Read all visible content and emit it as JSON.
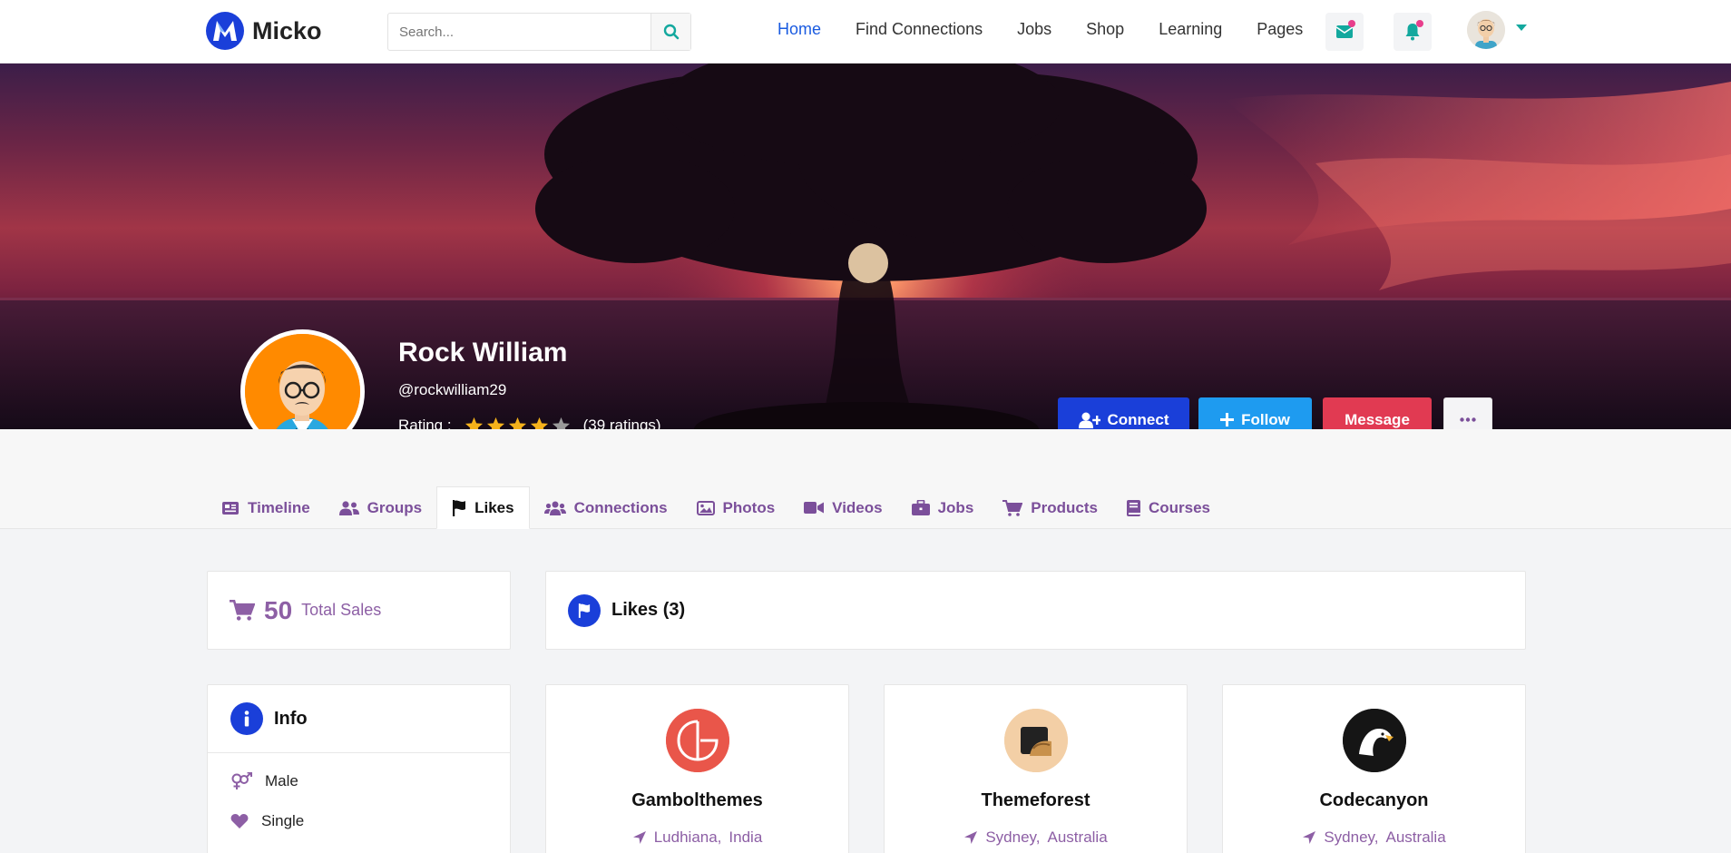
{
  "brand": {
    "name": "Micko",
    "accent": "#1a5be0"
  },
  "search": {
    "placeholder": "Search..."
  },
  "nav": [
    "Home",
    "Find Connections",
    "Jobs",
    "Shop",
    "Learning",
    "Pages"
  ],
  "header_icons": [
    "envelope-icon",
    "bell-icon"
  ],
  "profile": {
    "name": "Rock William",
    "handle": "@rockwilliam29",
    "rating_label": "Rating :",
    "rating_value": 4,
    "rating_max": 5,
    "rating_count": "(39 ratings)"
  },
  "actions": {
    "connect": "Connect",
    "follow": "Follow",
    "message": "Message"
  },
  "tabs": [
    "Timeline",
    "Groups",
    "Likes",
    "Connections",
    "Photos",
    "Videos",
    "Jobs",
    "Products",
    "Courses"
  ],
  "sales": {
    "count": "50",
    "label": "Total Sales"
  },
  "likes_section": {
    "title": "Likes (3)"
  },
  "info": {
    "title": "Info",
    "gender": "Male",
    "status": "Single"
  },
  "likes": [
    {
      "name": "Gambolthemes",
      "city": "Ludhiana,",
      "country": "India"
    },
    {
      "name": "Themeforest",
      "city": "Sydney,",
      "country": "Australia"
    },
    {
      "name": "Codecanyon",
      "city": "Sydney,",
      "country": "Australia"
    }
  ]
}
